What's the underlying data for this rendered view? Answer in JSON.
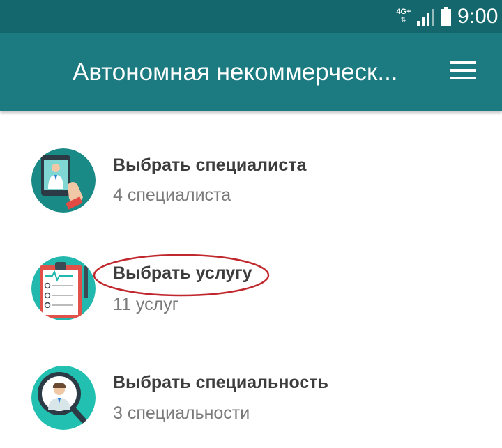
{
  "status_bar": {
    "network": "4G+",
    "network_arrows": "⇅",
    "clock": "9:00",
    "signal_icon": "signal-strength-icon",
    "battery_icon": "battery-icon"
  },
  "app_bar": {
    "title": "Автономная некоммерческ...",
    "menu_icon": "hamburger-menu-icon"
  },
  "menu_items": [
    {
      "label": "Выбрать специалиста",
      "subtitle": "4 специалиста",
      "icon": "doctor-tablet-icon"
    },
    {
      "label": "Выбрать услугу",
      "subtitle": "11 услуг",
      "icon": "clipboard-checklist-icon"
    },
    {
      "label": "Выбрать специальность",
      "subtitle": "3 специальности",
      "icon": "doctor-magnifier-icon"
    }
  ],
  "annotation": {
    "color": "#c0282d"
  },
  "colors": {
    "status_bar": "#14676c",
    "app_bar": "#1b7b80",
    "icon_teal": "#1aa8a0"
  }
}
